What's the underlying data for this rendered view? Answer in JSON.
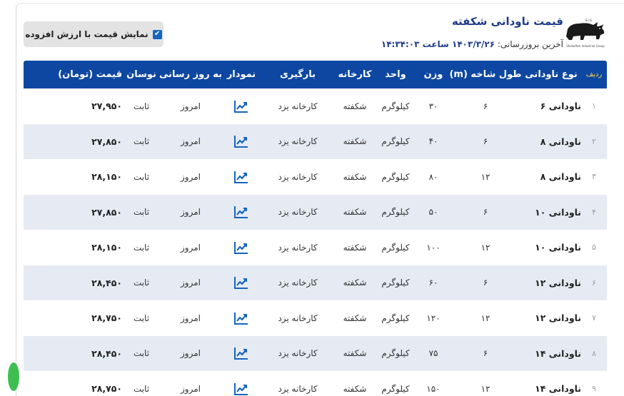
{
  "header": {
    "title": "قیمت ناودانی شکفته",
    "updated_label": "آخرین بروزرسانی:",
    "updated_value": "۱۴۰۳/۳/۲۶ ساعت ۱۴:۳۴:۰۳",
    "logo_tag": "Shekofteh Industrial Group",
    "logo_mark": "S.I.G"
  },
  "toggle": {
    "label": "نمایش قیمت با ارزش افزوده",
    "checked": true
  },
  "columns": {
    "idx": "ردیف",
    "type": "نوع ناودانی",
    "length": "طول شاخه (m)",
    "weight": "وزن",
    "unit": "واحد",
    "factory": "کارخانه",
    "loading": "بارگیری",
    "chart": "نمودار",
    "update": "به روز رسانی",
    "fluctuation": "نوسان",
    "price": "قیمت (تومان)"
  },
  "rows": [
    {
      "idx": "۱",
      "type": "ناودانی ۶",
      "length": "۶",
      "weight": "۳۰",
      "unit": "کیلوگرم",
      "factory": "شکفته",
      "loading": "کارخانه یزد",
      "update": "امروز",
      "fluctuation": "ثابت",
      "price": "۲۷,۹۵۰"
    },
    {
      "idx": "۲",
      "type": "ناودانی ۸",
      "length": "۶",
      "weight": "۴۰",
      "unit": "کیلوگرم",
      "factory": "شکفته",
      "loading": "کارخانه یزد",
      "update": "امروز",
      "fluctuation": "ثابت",
      "price": "۲۷,۸۵۰"
    },
    {
      "idx": "۳",
      "type": "ناودانی ۸",
      "length": "۱۲",
      "weight": "۸۰",
      "unit": "کیلوگرم",
      "factory": "شکفته",
      "loading": "کارخانه یزد",
      "update": "امروز",
      "fluctuation": "ثابت",
      "price": "۲۸,۱۵۰"
    },
    {
      "idx": "۴",
      "type": "ناودانی ۱۰",
      "length": "۶",
      "weight": "۵۰",
      "unit": "کیلوگرم",
      "factory": "شکفته",
      "loading": "کارخانه یزد",
      "update": "امروز",
      "fluctuation": "ثابت",
      "price": "۲۷,۸۵۰"
    },
    {
      "idx": "۵",
      "type": "ناودانی ۱۰",
      "length": "۱۲",
      "weight": "۱۰۰",
      "unit": "کیلوگرم",
      "factory": "شکفته",
      "loading": "کارخانه یزد",
      "update": "امروز",
      "fluctuation": "ثابت",
      "price": "۲۸,۱۵۰"
    },
    {
      "idx": "۶",
      "type": "ناودانی ۱۲",
      "length": "۶",
      "weight": "۶۰",
      "unit": "کیلوگرم",
      "factory": "شکفته",
      "loading": "کارخانه یزد",
      "update": "امروز",
      "fluctuation": "ثابت",
      "price": "۲۸,۴۵۰"
    },
    {
      "idx": "۷",
      "type": "ناودانی ۱۲",
      "length": "۱۲",
      "weight": "۱۲۰",
      "unit": "کیلوگرم",
      "factory": "شکفته",
      "loading": "کارخانه یزد",
      "update": "امروز",
      "fluctuation": "ثابت",
      "price": "۲۸,۷۵۰"
    },
    {
      "idx": "۸",
      "type": "ناودانی ۱۴",
      "length": "۶",
      "weight": "۷۵",
      "unit": "کیلوگرم",
      "factory": "شکفته",
      "loading": "کارخانه یزد",
      "update": "امروز",
      "fluctuation": "ثابت",
      "price": "۲۸,۴۵۰"
    },
    {
      "idx": "۹",
      "type": "ناودانی ۱۴",
      "length": "۱۲",
      "weight": "۱۵۰",
      "unit": "کیلوگرم",
      "factory": "شکفته",
      "loading": "کارخانه یزد",
      "update": "امروز",
      "fluctuation": "ثابت",
      "price": "۲۸,۷۵۰"
    }
  ],
  "icons": {
    "chart": "trend-chart-icon",
    "check": "checkmark-icon",
    "logo": "rhino-logo-icon"
  },
  "colors": {
    "header_bg": "#0d47a1",
    "title": "#1e3a8a",
    "alt_row": "#e6ebf3",
    "checkbox": "#1565c0"
  }
}
